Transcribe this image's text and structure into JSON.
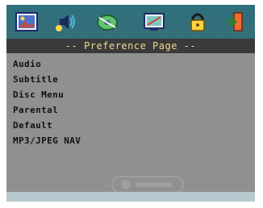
{
  "header": {
    "icons": [
      "picture-icon",
      "speaker-icon",
      "disc-icon",
      "screen-icon",
      "lock-icon",
      "exit-icon"
    ]
  },
  "title": "-- Preference Page --",
  "menu": {
    "items": [
      {
        "label": "Audio"
      },
      {
        "label": "Subtitle"
      },
      {
        "label": "Disc Menu"
      },
      {
        "label": "Parental"
      },
      {
        "label": "Default"
      },
      {
        "label": "MP3/JPEG NAV"
      }
    ]
  },
  "colors": {
    "topbar": "#2f6f7c",
    "titlebar": "#3a3a3a",
    "title_text": "#efd890",
    "background": "#8f9190",
    "bottom_strip": "#b7c9cf"
  }
}
